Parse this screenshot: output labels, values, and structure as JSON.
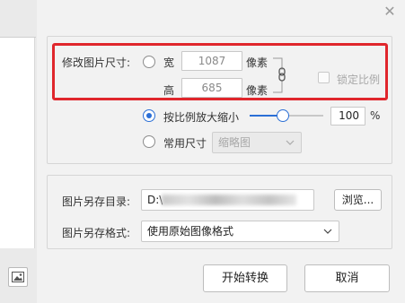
{
  "window": {
    "close_glyph": "✕"
  },
  "resize": {
    "section_label": "修改图片尺寸:",
    "width_label": "宽",
    "width_value": "1087",
    "width_unit": "像素",
    "height_label": "高",
    "height_value": "685",
    "height_unit": "像素",
    "lock_ratio_label": "锁定比例"
  },
  "scale": {
    "label": "按比例放大缩小",
    "value": "100",
    "unit": "%",
    "slider_fraction": 0.45
  },
  "common_size": {
    "label": "常用尺寸",
    "selected": "缩略图"
  },
  "save": {
    "dir_label": "图片另存目录:",
    "dir_value": "D:\\",
    "browse_label": "浏览...",
    "format_label": "图片另存格式:",
    "format_selected": "使用原始图像格式"
  },
  "buttons": {
    "start_label": "开始转换",
    "cancel_label": "取消"
  },
  "icons": {
    "close": "close-icon",
    "link": "link-icon",
    "image": "image-icon",
    "dropdown": "chevron-down-icon"
  }
}
